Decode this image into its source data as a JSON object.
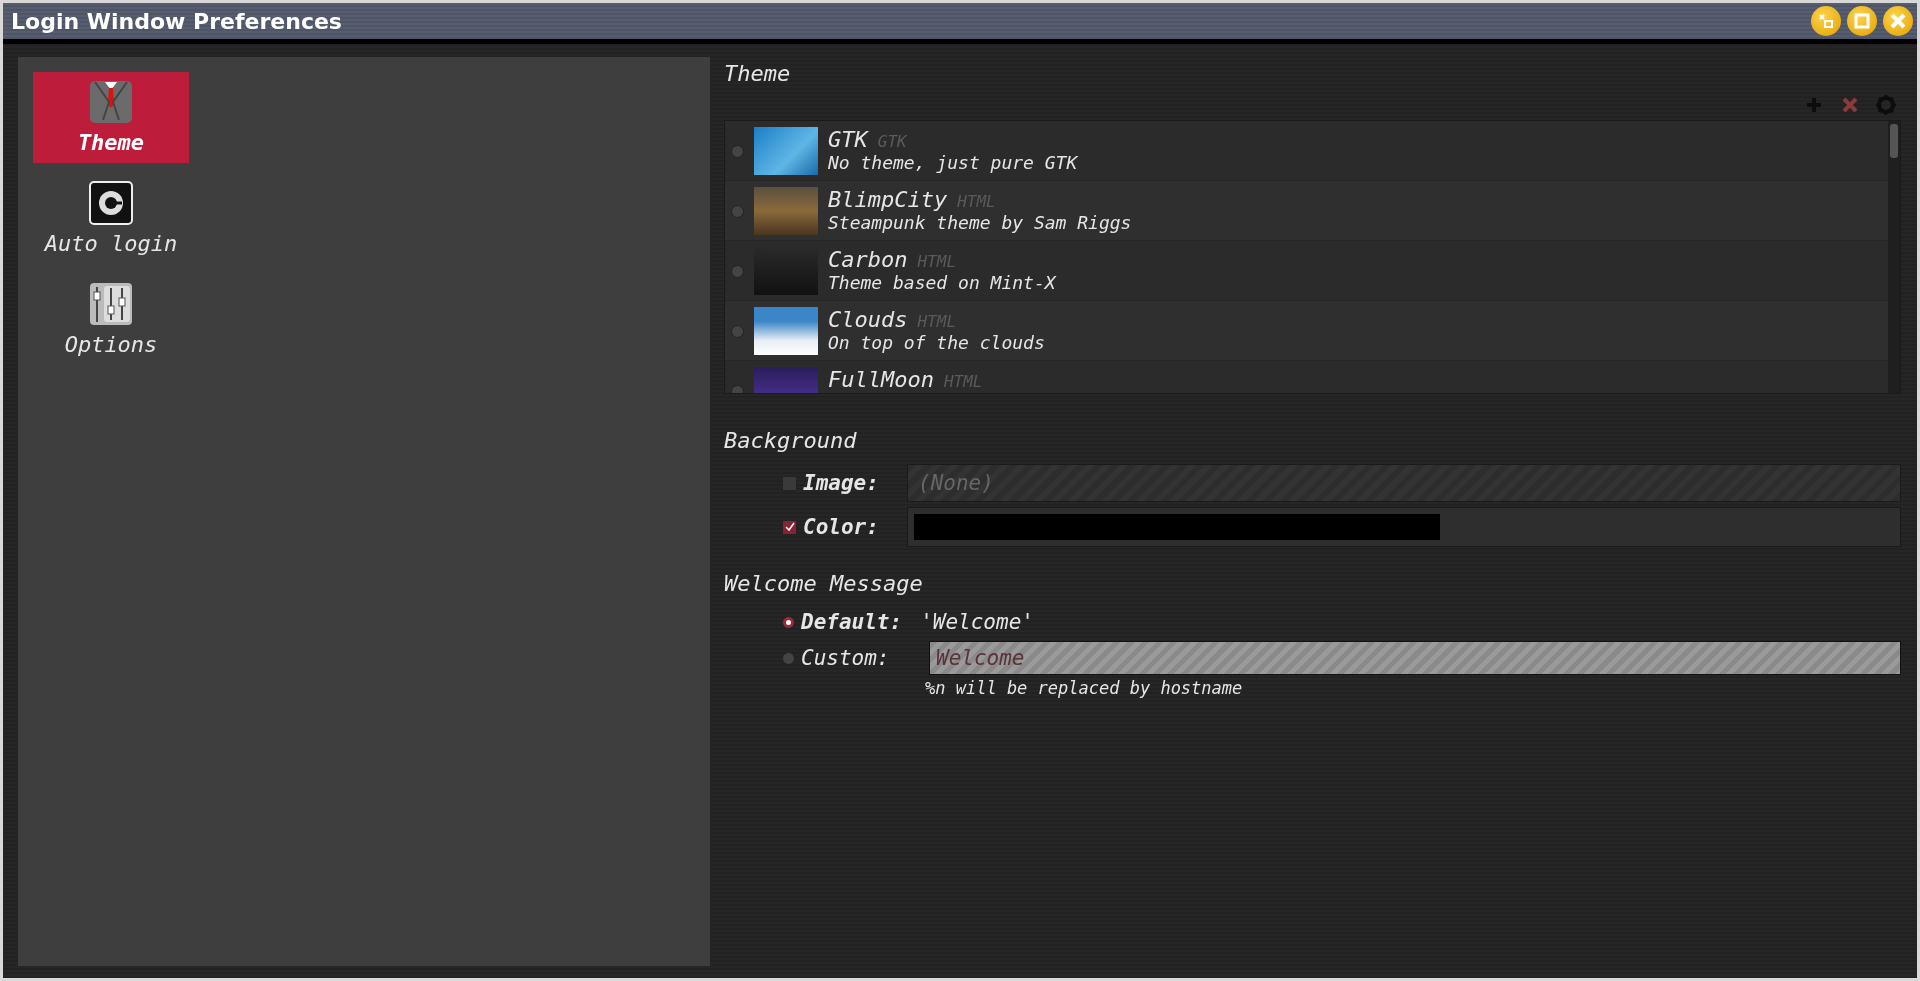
{
  "window": {
    "title": "Login Window Preferences"
  },
  "sidebar": {
    "items": [
      {
        "label": "Theme",
        "selected": true
      },
      {
        "label": "Auto login",
        "selected": false
      },
      {
        "label": "Options",
        "selected": false
      }
    ]
  },
  "theme": {
    "heading": "Theme",
    "themes": [
      {
        "name": "GTK",
        "type": "GTK",
        "description": "No theme, just pure GTK",
        "selected": false
      },
      {
        "name": "BlimpCity",
        "type": "HTML",
        "description": "Steampunk theme by Sam Riggs",
        "selected": false
      },
      {
        "name": "Carbon",
        "type": "HTML",
        "description": "Theme based on Mint-X",
        "selected": false
      },
      {
        "name": "Clouds",
        "type": "HTML",
        "description": "On top of the clouds",
        "selected": false
      },
      {
        "name": "FullMoon",
        "type": "HTML",
        "selected": false
      }
    ]
  },
  "background": {
    "heading": "Background",
    "image": {
      "label": "Image:",
      "checked": false,
      "value": "(None)"
    },
    "color": {
      "label": "Color:",
      "checked": true,
      "color": "#000000"
    }
  },
  "welcome": {
    "heading": "Welcome Message",
    "default": {
      "label": "Default:",
      "text": "'Welcome'",
      "selected": true
    },
    "custom": {
      "label": "Custom:",
      "value": "Welcome",
      "selected": false
    },
    "hint": "%n will be replaced by hostname"
  }
}
